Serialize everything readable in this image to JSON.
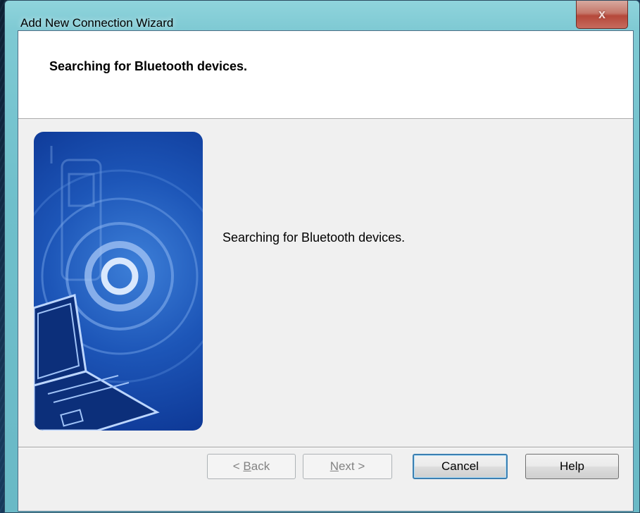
{
  "window": {
    "title": "Add New Connection Wizard",
    "close_symbol": "x"
  },
  "header": {
    "title": "Searching for Bluetooth devices."
  },
  "body": {
    "message": "Searching for Bluetooth devices."
  },
  "image": {
    "icon": "bluetooth-search-illustration-icon"
  },
  "buttons": {
    "back": {
      "accel": "B",
      "rest": "ack",
      "prefix": "< ",
      "enabled": false
    },
    "next": {
      "accel": "N",
      "rest": "ext >",
      "enabled": false
    },
    "cancel": {
      "label": "Cancel",
      "enabled": true
    },
    "help": {
      "label": "Help",
      "enabled": true
    }
  },
  "colors": {
    "title_bar": "#7ec9d3",
    "close_button": "#c5776a",
    "dialog_bg": "#f0f0f0",
    "illustration_blue": "#1d56b8"
  }
}
